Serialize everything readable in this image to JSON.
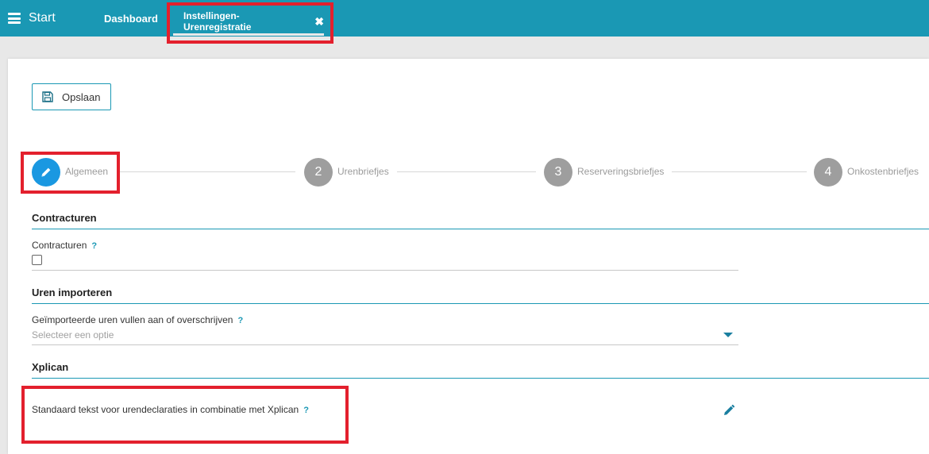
{
  "topbar": {
    "start_label": "Start",
    "dashboard_tab": "Dashboard",
    "active_tab": "Instellingen-Urenregistratie",
    "close_glyph": "✖"
  },
  "toolbar": {
    "save_label": "Opslaan"
  },
  "stepper": {
    "steps": [
      {
        "number": "1",
        "label": "Algemeen",
        "active": true
      },
      {
        "number": "2",
        "label": "Urenbriefjes",
        "active": false
      },
      {
        "number": "3",
        "label": "Reserveringsbriefjes",
        "active": false
      },
      {
        "number": "4",
        "label": "Onkostenbriefjes",
        "active": false
      }
    ]
  },
  "sections": {
    "contracturen": {
      "title": "Contracturen",
      "field_label": "Contracturen",
      "help": "?",
      "checked": false
    },
    "uren_importeren": {
      "title": "Uren importeren",
      "field_label": "Geïmporteerde uren vullen aan of overschrijven",
      "help": "?",
      "placeholder": "Selecteer een optie"
    },
    "xplican": {
      "title": "Xplican",
      "field_label": "Standaard tekst voor urendeclaraties in combinatie met Xplican",
      "help": "?"
    }
  },
  "icons": {
    "menu": "hamburger-icon",
    "save": "floppy-disk-icon",
    "step1": "pencil-icon",
    "edit": "pencil-icon",
    "select": "caret-down-icon"
  },
  "colors": {
    "accent": "#1a98b4",
    "step_active": "#1a98e1",
    "step_inactive": "#9e9e9e",
    "highlight": "#e3202d"
  }
}
